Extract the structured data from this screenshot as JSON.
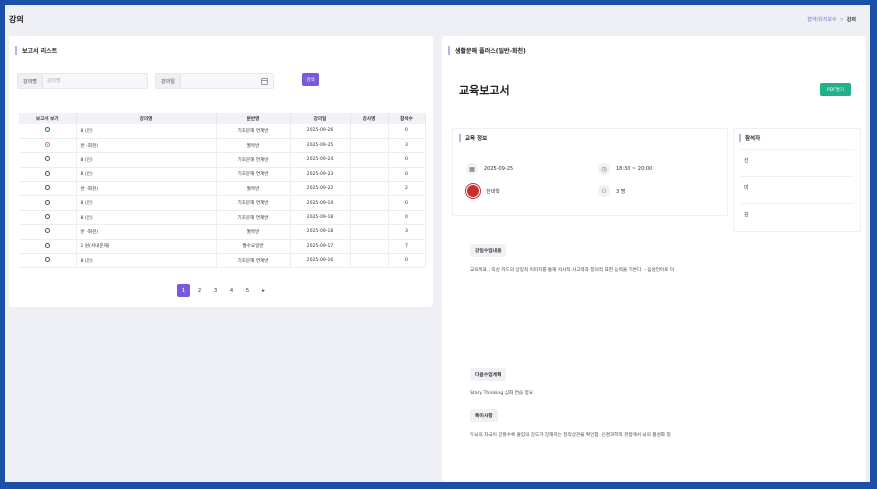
{
  "header": {
    "page_title": "강의",
    "breadcrumb": [
      "협약/유지보수",
      "강의"
    ]
  },
  "left_panel": {
    "title": "보고서 리스트",
    "search": {
      "lecture_name_label": "강의명",
      "lecture_name_placeholder": "강의명",
      "lecture_date_label": "강의일",
      "search_button": "검색"
    },
    "columns": [
      "보고서 보기",
      "강의명",
      "분반명",
      "강의일",
      "강사명",
      "참석수"
    ],
    "rows": [
      {
        "name": "8 (인)",
        "section": "기초문해 연계반",
        "date": "2025-09-26",
        "instructor": "",
        "count": "0",
        "selected": false
      },
      {
        "name": "반 -화천)",
        "section": "월목반",
        "date": "2025-09-25",
        "instructor": "",
        "count": "3",
        "selected": true
      },
      {
        "name": "8 (인)",
        "section": "기초문해 연계반",
        "date": "2025-09-24",
        "instructor": "",
        "count": "0",
        "selected": false
      },
      {
        "name": "8 (인)",
        "section": "기초문해 연계반",
        "date": "2025-09-23",
        "instructor": "",
        "count": "0",
        "selected": false
      },
      {
        "name": "반 -화천)",
        "section": "월목반",
        "date": "2025-09-22",
        "instructor": "",
        "count": "2",
        "selected": false
      },
      {
        "name": "8 (인)",
        "section": "기초문해 연계반",
        "date": "2025-09-19",
        "instructor": "",
        "count": "0",
        "selected": false
      },
      {
        "name": "8 (인)",
        "section": "기초문해 연계반",
        "date": "2025-09-18",
        "instructor": "",
        "count": "0",
        "selected": false
      },
      {
        "name": "반 -화천)",
        "section": "월목반",
        "date": "2025-09-18",
        "instructor": "",
        "count": "3",
        "selected": false
      },
      {
        "name": "1 원(서내문해)",
        "section": "월수요일반",
        "date": "2025-09-17",
        "instructor": "",
        "count": "7",
        "selected": false
      },
      {
        "name": "8 (인)",
        "section": "기초문해 연계반",
        "date": "2025-09-16",
        "instructor": "",
        "count": "0",
        "selected": false
      }
    ],
    "pagination": {
      "pages": [
        "1",
        "2",
        "3",
        "4",
        "5"
      ],
      "current": "1",
      "next": "▸"
    }
  },
  "right_panel": {
    "title": "생활문해 플러스(일반-화천)",
    "report_title": "교육보고서",
    "pdf_button": "PDF발기",
    "info": {
      "heading": "교육 정보",
      "date": "2025-09-25",
      "time": "18:30 ~ 20:00",
      "school": "한대학",
      "attendees": "3 명"
    },
    "attendance": {
      "heading": "참석자",
      "names": [
        "선",
        "미",
        "김"
      ]
    },
    "sections": [
      {
        "tag": "강일수업내용",
        "text": "교육목표 : 익싱 카드의 상징적 이미지를 통해 서사적 사고력과 창의적 표현 능력을 기른다. - 음성언어로 이"
      },
      {
        "tag": "다음수업계획",
        "text": "Story Thinking 심화 연습 정요"
      },
      {
        "tag": "특이사항",
        "text": "두뇌의 자극이 강할수록 몰입의 강도가 강해지는 정적상관을 확인함. 신경과학적 관점에서 뇌의 활성화 정"
      }
    ]
  }
}
